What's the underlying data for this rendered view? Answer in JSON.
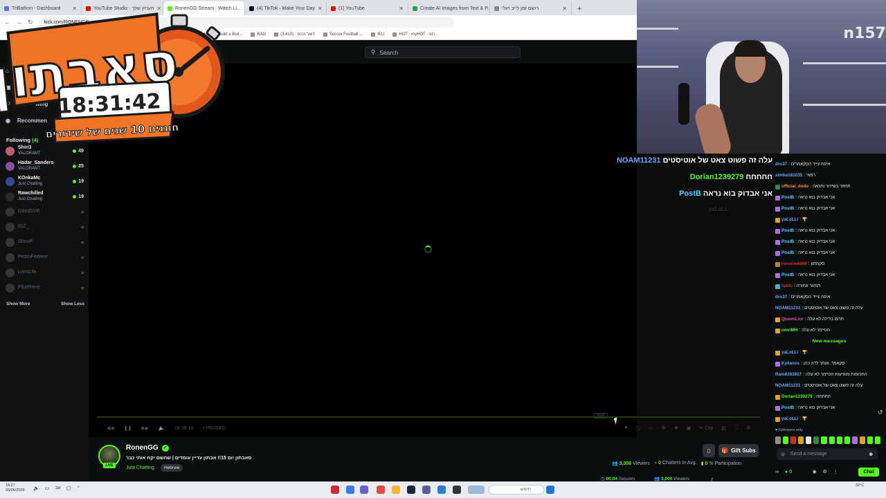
{
  "browser": {
    "tabs": [
      {
        "label": "TriBathon - Dashboard",
        "color": "#6b63ff"
      },
      {
        "label": "YouTube Studio - הערוץ שלך",
        "color": "#ff0000"
      },
      {
        "label": "RonenGG Stream - Watch Li...",
        "color": "#53fc18",
        "active": true
      },
      {
        "label": "(4) TikTok - Make Your Day",
        "color": "#111111"
      },
      {
        "label": "(1) YouTube",
        "color": "#ff0000"
      },
      {
        "label": "Create AI Images from Text & P...",
        "color": "#2e9e4f"
      },
      {
        "label": "רושם זמן לייב רגלי",
        "color": "#888888"
      }
    ],
    "new_tab": "+",
    "url": "kick.com/RONENGG",
    "bookmarks": [
      "ownload",
      "ovs",
      "ed",
      "CS: Global Offensive",
      "Discount Bank - Inv...",
      "How to Build a Buil...",
      "RAG",
      "(3,410) - דואר נכנס",
      "Soccer Football ...",
      "IEU",
      "HOT - myHOT - תפ..."
    ]
  },
  "timer_overlay": {
    "title": "סאבתון",
    "time": "18:31:42",
    "subtitle": "חוגגים 10 שנים של שידורים"
  },
  "kick": {
    "search_placeholder": "Search",
    "nav": [
      {
        "label": "",
        "icon": "home-icon"
      },
      {
        "label": "",
        "icon": "browse-icon"
      },
      {
        "label": "wing",
        "icon": "following-icon"
      },
      {
        "label": "Recommen",
        "icon": "recommended-icon"
      }
    ],
    "following_label": "Following",
    "following_count": "(4)",
    "following": [
      {
        "name": "Shiri3",
        "game": "VALORANT",
        "viewers": "49",
        "color": "#c25b76",
        "live": true
      },
      {
        "name": "Hadar_Sanders",
        "game": "VALORANT",
        "viewers": "25",
        "color": "#8a4f9e",
        "live": true
      },
      {
        "name": "KOnkaMc",
        "game": "Just Chatting",
        "viewers": "19",
        "color": "#2d4d8f",
        "live": true
      },
      {
        "name": "Rawchilled",
        "game": "Just Chatting",
        "viewers": "19",
        "color": "#2a2a2a",
        "live": true
      },
      {
        "name": "OdedSVR",
        "game": "",
        "viewers": "",
        "color": "#777",
        "live": false
      },
      {
        "name": "IGZ_",
        "game": "",
        "viewers": "",
        "color": "#777",
        "live": false
      },
      {
        "name": "ShonP",
        "game": "",
        "viewers": "",
        "color": "#777",
        "live": false
      },
      {
        "name": "PedroFederer",
        "game": "",
        "viewers": "",
        "color": "#777",
        "live": false
      },
      {
        "name": "LiorsLife",
        "game": "",
        "viewers": "",
        "color": "#777",
        "live": false
      },
      {
        "name": "FlintPrime",
        "game": "",
        "viewers": "",
        "color": "#777",
        "live": false
      }
    ],
    "show_more": "Show More",
    "show_less": "Show Less",
    "player": {
      "time": "18:38:19",
      "state": "PAUSED",
      "clip_label": "Clip",
      "new_label": "NEW"
    },
    "stream": {
      "channel": "RonenGG",
      "live_badge": "LIVE",
      "title": "סאבתון יום 15!! אבתון עדיין עומדים | שהשם יקח אותי כבר",
      "category": "Just Chatting",
      "language": "Hebrew",
      "gift_subs": "Gift Subs",
      "viewers": "3,308",
      "viewers_label": "Viewers",
      "chatters_value": "0",
      "chatters_label": "Chatters In Avg.",
      "participation_value": "0",
      "participation_label": "% Participation",
      "session_time": "00:04",
      "session_label": "Session",
      "peak_viewers": "3,000",
      "peak_label": "Viewers"
    }
  },
  "stream_overlay": {
    "cam_tag": "n157",
    "alerts": [
      {
        "user": "NOAM11231",
        "text": "עלה זה פשוט צאט של אוטיסטים",
        "color": "#6aa7ff"
      },
      {
        "user": "Dorian1239279",
        "text": "חחחחח",
        "color": "#53fc18"
      },
      {
        "user": "PostB",
        "text": "אני אבדוק בוא נראה",
        "color": "#4ad3ff"
      }
    ],
    "faded": "yaLoLL"
  },
  "chat": {
    "messages": [
      {
        "user": "dro37",
        "text": "איפה צייד הסקאמרים",
        "color": "#6aa7ff",
        "badge": ""
      },
      {
        "user": "simba181035",
        "text": "רמאי",
        "color": "#6aa7ff",
        "badge": ""
      },
      {
        "user": "official_dodo",
        "text": "תחזור בשידור ותראה",
        "color": "#ff8a3d",
        "badge": "#2f8a3a"
      },
      {
        "user": "PostB",
        "text": "אני אבדוק בוא נראה",
        "color": "#4ad3ff",
        "badge": "#b06be6"
      },
      {
        "user": "PostB",
        "text": "אני אבדוק בוא נראה",
        "color": "#4ad3ff",
        "badge": "#b06be6"
      },
      {
        "user": "yaLoLLi",
        "text": "🏆",
        "color": "#6aa7ff",
        "badge": "#d9a221"
      },
      {
        "user": "PostB",
        "text": "אני אבדוק בוא נראה",
        "color": "#4ad3ff",
        "badge": "#b06be6"
      },
      {
        "user": "PostB",
        "text": "אני אבדוק בוא נראה",
        "color": "#4ad3ff",
        "badge": "#b06be6"
      },
      {
        "user": "PostB",
        "text": "אני אבדוק בוא נראה",
        "color": "#4ad3ff",
        "badge": "#b06be6"
      },
      {
        "user": "ronenie6868",
        "text": "סקמתון",
        "color": "#d6263b",
        "badge": "#c4743c"
      },
      {
        "user": "PostB",
        "text": "אני אבדוק בוא נראה",
        "color": "#4ad3ff",
        "badge": "#b06be6"
      },
      {
        "user": "liekfc",
        "text": "תחזור אחורה",
        "color": "#d6263b",
        "badge": "#3fb3c8"
      },
      {
        "user": "dro37",
        "text": "איפה צייד הסקאמרים",
        "color": "#6aa7ff",
        "badge": ""
      },
      {
        "user": "NOAM11231",
        "text": "עלה זה פשוט צאט של אוטיסטים",
        "color": "#6aa7ff",
        "badge": ""
      },
      {
        "user": "QueenLior",
        "text": "תרמו בלילה לא עלה",
        "color": "#e04aa8",
        "badge": "#d9a221"
      },
      {
        "user": "omriMH",
        "text": "הטיימר לא עלה",
        "color": "#53fc18",
        "badge": "#d9a221"
      },
      {
        "user": "yaLoLLi",
        "text": "🏆",
        "color": "#6aa7ff",
        "badge": "#d9a221"
      },
      {
        "user": "Kylianos",
        "text": "סקאמר, אותך לדה כהן",
        "color": "#6aa7ff",
        "badge": "#b06be6"
      },
      {
        "user": "Ram8393937",
        "text": "התרומות מופיעות הטיימר לא עלה",
        "color": "#6aa7ff",
        "badge": ""
      },
      {
        "user": "NOAM11231",
        "text": "עלה זה פשוט צאט של אוטיסטים",
        "color": "#6aa7ff",
        "badge": ""
      },
      {
        "user": "Dorian1239279",
        "text": "חחחחח",
        "color": "#53fc18",
        "badge": "#d9a221"
      },
      {
        "user": "PostB",
        "text": "אני אבדוק בוא נראה",
        "color": "#4ad3ff",
        "badge": "#b06be6"
      },
      {
        "user": "yaLoLLi",
        "text": "🏆",
        "color": "#6aa7ff",
        "badge": "#d9a221"
      }
    ],
    "new_messages": "New messages",
    "followers_only": "Followers only",
    "input_placeholder": "Send a message",
    "points": "0",
    "chat_button": "Chat"
  },
  "taskbar": {
    "time": "18:27",
    "date": "03/06/2026",
    "weather": "32°C",
    "search_text": "חיפוש"
  }
}
